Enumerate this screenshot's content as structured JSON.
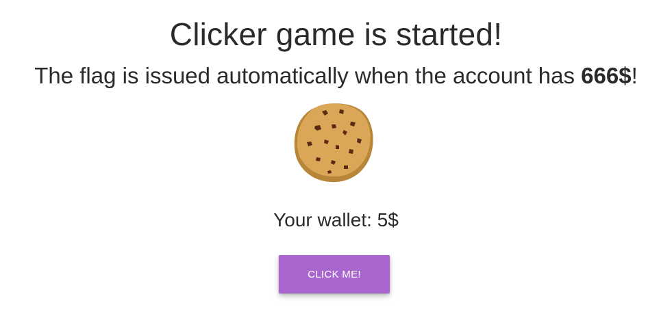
{
  "title": "Clicker game is started!",
  "subtitle": {
    "prefix": "The flag is issued automatically when the account has ",
    "amount": "666$",
    "suffix": "!"
  },
  "cookie": {
    "icon": "cookie-icon"
  },
  "wallet": {
    "text": "Your wallet: 5$"
  },
  "button": {
    "label": "CLICK ME!",
    "color": "#a966cf"
  }
}
